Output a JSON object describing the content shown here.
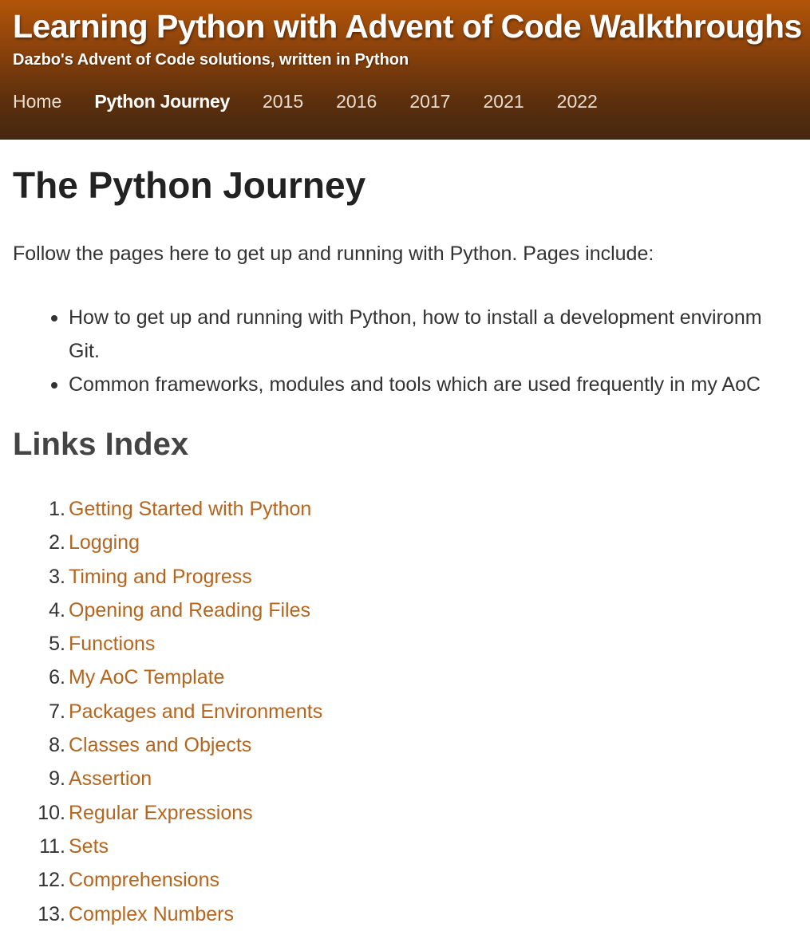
{
  "header": {
    "title": "Learning Python with Advent of Code Walkthroughs",
    "subtitle": "Dazbo's Advent of Code solutions, written in Python",
    "nav": [
      {
        "label": "Home",
        "active": false
      },
      {
        "label": "Python Journey",
        "active": true
      },
      {
        "label": "2015",
        "active": false
      },
      {
        "label": "2016",
        "active": false
      },
      {
        "label": "2017",
        "active": false
      },
      {
        "label": "2021",
        "active": false
      },
      {
        "label": "2022",
        "active": false
      }
    ]
  },
  "main": {
    "title": "The Python Journey",
    "intro": "Follow the pages here to get up and running with Python. Pages include:",
    "bullets": [
      {
        "line1": "How to get up and running with Python, how to install a development environm",
        "line2": "Git."
      },
      {
        "line1": "Common frameworks, modules and tools which are used frequently in my AoC",
        "line2": ""
      }
    ],
    "links_title": "Links Index",
    "links": [
      {
        "num": "1.",
        "label": "Getting Started with Python"
      },
      {
        "num": "2.",
        "label": "Logging"
      },
      {
        "num": "3.",
        "label": "Timing and Progress"
      },
      {
        "num": "4.",
        "label": "Opening and Reading Files"
      },
      {
        "num": "5.",
        "label": "Functions"
      },
      {
        "num": "6.",
        "label": "My AoC Template"
      },
      {
        "num": "7.",
        "label": "Packages and Environments"
      },
      {
        "num": "8.",
        "label": "Classes and Objects"
      },
      {
        "num": "9.",
        "label": "Assertion"
      },
      {
        "num": "10.",
        "label": "Regular Expressions"
      },
      {
        "num": "11.",
        "label": "Sets"
      },
      {
        "num": "12.",
        "label": "Comprehensions"
      },
      {
        "num": "13.",
        "label": "Complex Numbers"
      }
    ]
  },
  "colors": {
    "header_top": "#b2550a",
    "header_bottom": "#452710",
    "link": "#b5651d",
    "heading": "#222222"
  }
}
